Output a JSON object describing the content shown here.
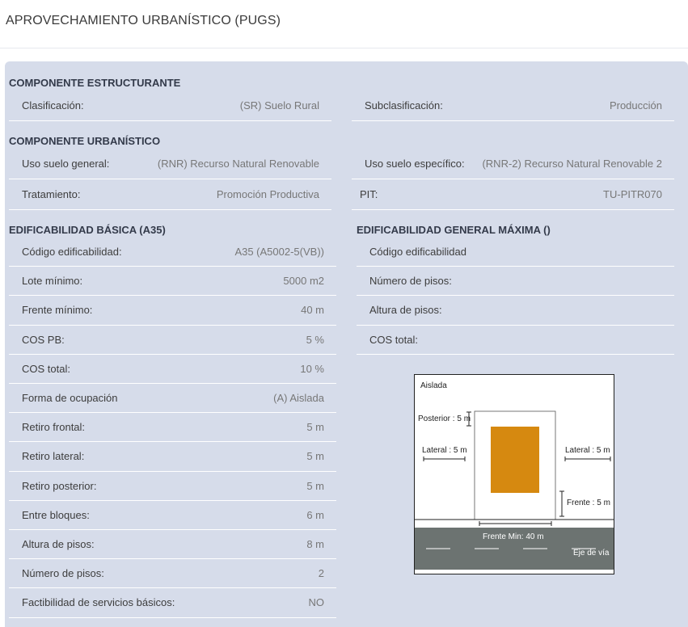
{
  "header": {
    "title": "APROVECHAMIENTO URBANÍSTICO (PUGS)"
  },
  "estructurante": {
    "title": "COMPONENTE ESTRUCTURANTE",
    "rows": [
      {
        "label": "Clasificación:",
        "value": "(SR) Suelo Rural"
      },
      {
        "label": "Subclasificación:",
        "value": "Producción"
      }
    ]
  },
  "urbanistico": {
    "title": "COMPONENTE URBANÍSTICO",
    "rows": [
      {
        "label": "Uso suelo general:",
        "value": "(RNR) Recurso Natural Renovable"
      },
      {
        "label": "Uso suelo específico:",
        "value": "(RNR-2) Recurso Natural Renovable 2"
      },
      {
        "label": "Tratamiento:",
        "value": "Promoción Productiva"
      },
      {
        "label": "PIT:",
        "value": "TU-PITR070"
      }
    ]
  },
  "basica": {
    "title": "EDIFICABILIDAD BÁSICA (A35)",
    "rows": [
      {
        "label": "Código edificabilidad:",
        "value": "A35 (A5002-5(VB))"
      },
      {
        "label": "Lote mínimo:",
        "value": "5000 m2"
      },
      {
        "label": "Frente mínimo:",
        "value": "40 m"
      },
      {
        "label": "COS PB:",
        "value": "5 %"
      },
      {
        "label": "COS total:",
        "value": "10 %"
      },
      {
        "label": "Forma de ocupación",
        "value": "(A) Aislada"
      },
      {
        "label": "Retiro frontal:",
        "value": "5 m"
      },
      {
        "label": "Retiro lateral:",
        "value": "5 m"
      },
      {
        "label": "Retiro posterior:",
        "value": "5 m"
      },
      {
        "label": "Entre bloques:",
        "value": "6 m"
      },
      {
        "label": "Altura de pisos:",
        "value": "8 m"
      },
      {
        "label": "Número de pisos:",
        "value": "2"
      },
      {
        "label": "Factibilidad de servicios básicos:",
        "value": "NO"
      }
    ]
  },
  "maxima": {
    "title": "EDIFICABILIDAD GENERAL MÁXIMA ()",
    "rows": [
      {
        "label": "Código edificabilidad",
        "value": ""
      },
      {
        "label": "Número de pisos:",
        "value": ""
      },
      {
        "label": "Altura de pisos:",
        "value": ""
      },
      {
        "label": "COS total:",
        "value": ""
      }
    ]
  },
  "diagram": {
    "type_label": "Aislada",
    "posterior": "Posterior : 5 m",
    "lateral_left": "Lateral : 5 m",
    "lateral_right": "Lateral : 5 m",
    "frente": "Frente : 5 m",
    "frente_min": "Frente Min: 40 m",
    "eje_via": "Eje de vía",
    "colors": {
      "building": "#d68910",
      "road": "#6c7371"
    }
  }
}
